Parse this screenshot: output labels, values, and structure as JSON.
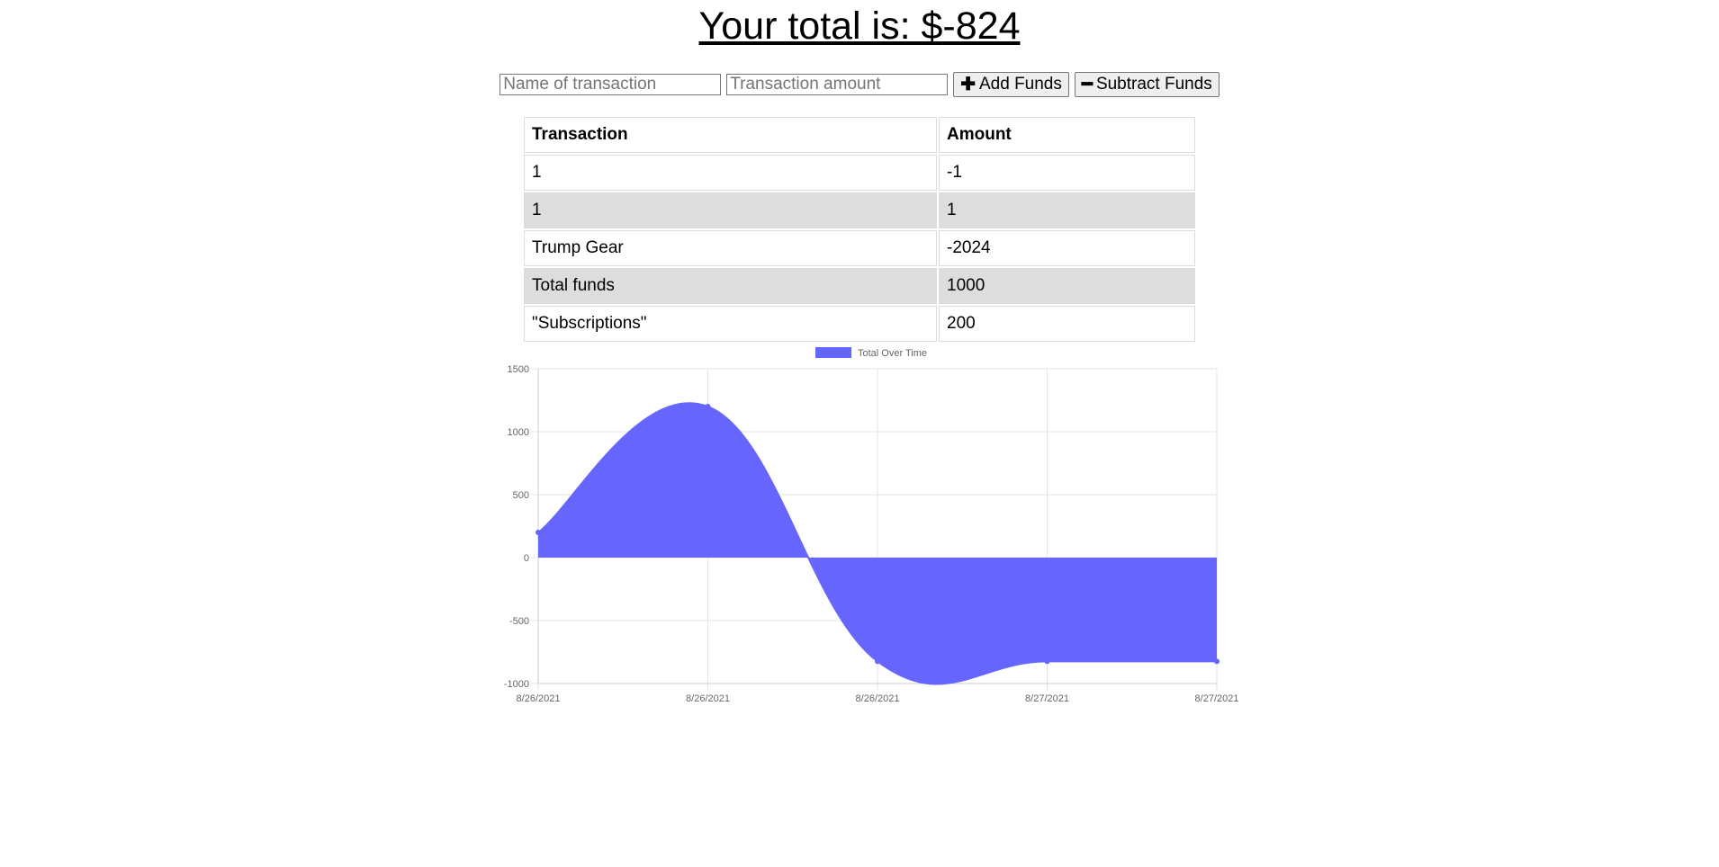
{
  "header": {
    "total_label": "Your total is: $",
    "total_value": "-824"
  },
  "form": {
    "name_placeholder": "Name of transaction",
    "amount_placeholder": "Transaction amount",
    "add_label": "Add Funds",
    "subtract_label": "Subtract Funds"
  },
  "table": {
    "headers": [
      "Transaction",
      "Amount"
    ],
    "rows": [
      {
        "name": "1",
        "amount": "-1"
      },
      {
        "name": "1",
        "amount": "1"
      },
      {
        "name": "Trump Gear",
        "amount": "-2024"
      },
      {
        "name": "Total funds",
        "amount": "1000"
      },
      {
        "name": "\"Subscriptions\"",
        "amount": "200"
      }
    ]
  },
  "chart_data": {
    "type": "area",
    "legend": "Total Over Time",
    "legend_position": "top",
    "color": "#6666ff",
    "x": [
      "8/26/2021",
      "8/26/2021",
      "8/26/2021",
      "8/27/2021",
      "8/27/2021"
    ],
    "values": [
      200,
      1200,
      -824,
      -824,
      -824
    ],
    "ylim": [
      -1000,
      1500
    ],
    "yticks": [
      1500,
      1000,
      500,
      0,
      -500,
      -1000
    ],
    "grid": true,
    "title": "",
    "xlabel": "",
    "ylabel": ""
  }
}
